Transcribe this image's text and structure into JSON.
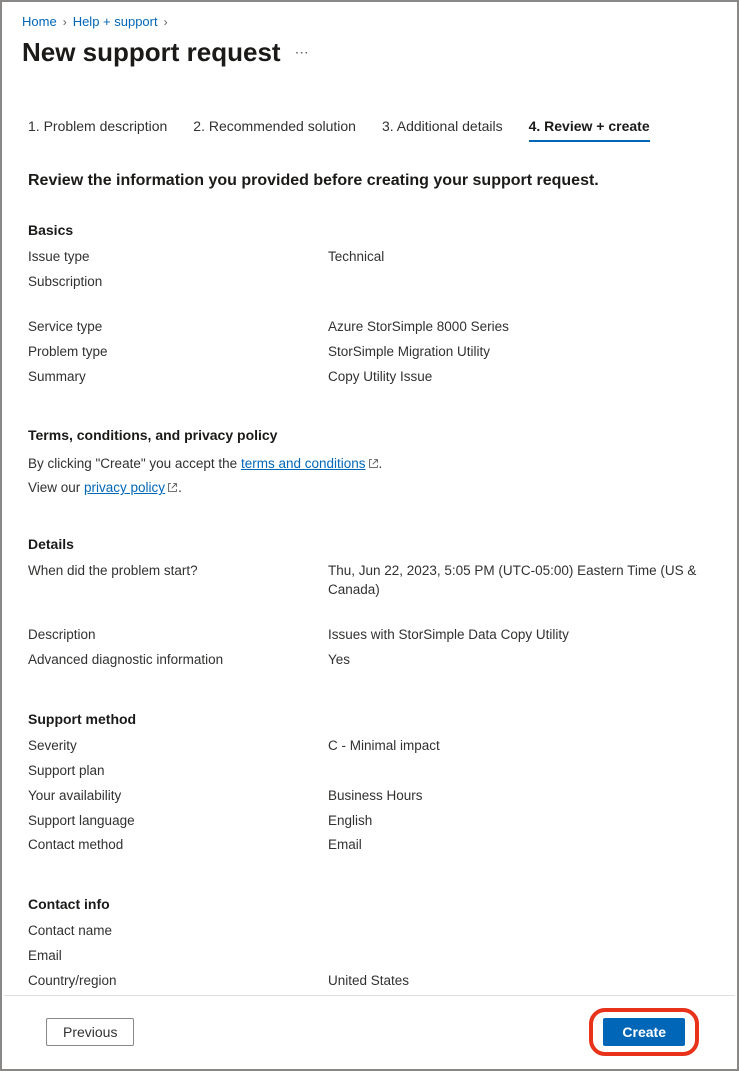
{
  "breadcrumb": {
    "home": "Home",
    "help": "Help + support"
  },
  "page_title": "New support request",
  "tabs": [
    "1. Problem description",
    "2. Recommended solution",
    "3. Additional details",
    "4. Review + create"
  ],
  "review_heading": "Review the information you provided before creating your support request.",
  "sections": {
    "basics": {
      "title": "Basics",
      "rows": {
        "issue_type": {
          "label": "Issue type",
          "value": "Technical"
        },
        "subscription": {
          "label": "Subscription",
          "value": ""
        },
        "service_type": {
          "label": "Service type",
          "value": "Azure StorSimple 8000 Series"
        },
        "problem_type": {
          "label": "Problem type",
          "value": "StorSimple Migration Utility"
        },
        "summary": {
          "label": "Summary",
          "value": "Copy Utility Issue"
        }
      }
    },
    "terms": {
      "title": "Terms, conditions, and privacy policy",
      "line1_prefix": "By clicking \"Create\" you accept the ",
      "line1_link": "terms and conditions",
      "line2_prefix": "View our ",
      "line2_link": "privacy policy"
    },
    "details": {
      "title": "Details",
      "rows": {
        "when": {
          "label": "When did the problem start?",
          "value": "Thu, Jun 22, 2023, 5:05 PM (UTC-05:00) Eastern Time (US & Canada)"
        },
        "description": {
          "label": "Description",
          "value": "Issues with StorSimple Data Copy Utility"
        },
        "diag": {
          "label": "Advanced diagnostic information",
          "value": "Yes"
        }
      }
    },
    "support_method": {
      "title": "Support method",
      "rows": {
        "severity": {
          "label": "Severity",
          "value": "C - Minimal impact"
        },
        "plan": {
          "label": "Support plan",
          "value": ""
        },
        "availability": {
          "label": "Your availability",
          "value": "Business Hours"
        },
        "language": {
          "label": "Support language",
          "value": "English"
        },
        "contact_method": {
          "label": "Contact method",
          "value": "Email"
        }
      }
    },
    "contact_info": {
      "title": "Contact info",
      "rows": {
        "name": {
          "label": "Contact name",
          "value": ""
        },
        "email": {
          "label": "Email",
          "value": ""
        },
        "country": {
          "label": "Country/region",
          "value": "United States"
        }
      }
    }
  },
  "footer": {
    "previous": "Previous",
    "create": "Create"
  }
}
